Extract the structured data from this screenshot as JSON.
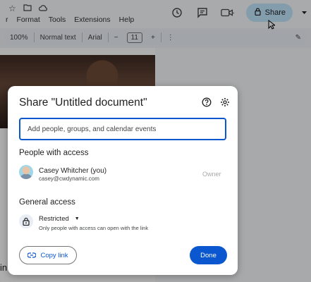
{
  "menus": [
    "r",
    "Format",
    "Tools",
    "Extensions",
    "Help"
  ],
  "toolbar": {
    "zoom": "100%",
    "style": "Normal text",
    "font": "Arial",
    "minus": "−",
    "font_size": "11",
    "plus": "+"
  },
  "header": {
    "share_label": "Share"
  },
  "doc": {
    "visible_text": "in"
  },
  "dialog": {
    "title": "Share \"Untitled document\"",
    "input_placeholder": "Add people, groups, and calendar events",
    "people_heading": "People with access",
    "user": {
      "name": "Casey Whitcher (you)",
      "email": "casey@cwdynamic.com",
      "role": "Owner"
    },
    "general_heading": "General access",
    "access_level": "Restricted",
    "access_description": "Only people with access can open with the link",
    "copy_link_label": "Copy link",
    "done_label": "Done"
  },
  "colors": {
    "primary": "#0b57d0",
    "share_bg": "#c2e7ff"
  },
  "icons": [
    "star-icon",
    "folder-icon",
    "cloud-icon",
    "history-icon",
    "comment-icon",
    "meet-icon",
    "lock-icon",
    "help-icon",
    "gear-icon",
    "link-icon",
    "pencil-icon",
    "more-icon"
  ]
}
